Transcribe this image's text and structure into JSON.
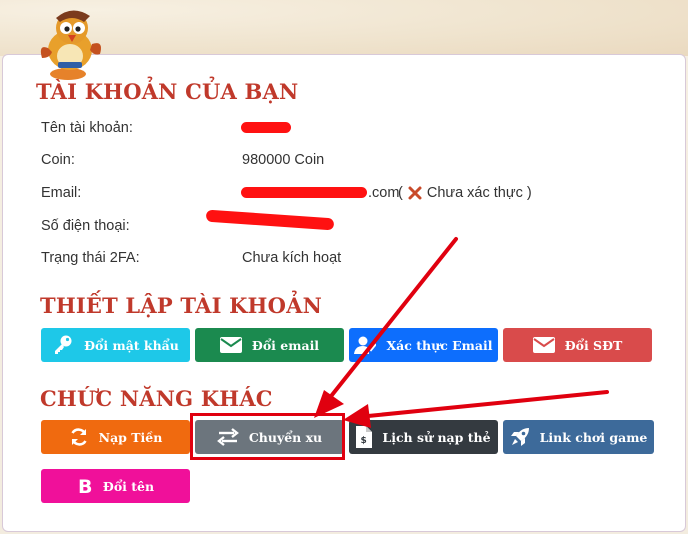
{
  "account": {
    "title": "TÀI KHOẢN CỦA BẠN",
    "rows": [
      {
        "label": "Tên tài khoản:",
        "value": ""
      },
      {
        "label": "Coin:",
        "value": "980000 Coin"
      },
      {
        "label": "Email:",
        "value": ".com"
      },
      {
        "label": "Số điện thoại:",
        "value": ""
      },
      {
        "label": "Trạng thái 2FA:",
        "value": "Chưa kích hoạt"
      }
    ],
    "email_status": "Chưa xác thực"
  },
  "settings": {
    "title": "THIẾT LẬP TÀI KHOẢN",
    "buttons": [
      {
        "label": "Đổi mật khẩu",
        "icon": "key-icon",
        "color": "#1ec8e8"
      },
      {
        "label": "Đổi email",
        "icon": "envelope-icon",
        "color": "#1b8a4f"
      },
      {
        "label": "Xác thực Email",
        "icon": "user-check-icon",
        "color": "#0d6efd"
      },
      {
        "label": "Đổi SĐT",
        "icon": "envelope-icon",
        "color": "#d94b4b"
      }
    ]
  },
  "other": {
    "title": "CHỨC NĂNG KHÁC",
    "buttons": [
      {
        "label": "Nạp Tiền",
        "icon": "refresh-icon",
        "color": "#f06a0f"
      },
      {
        "label": "Chuyển xu",
        "icon": "exchange-icon",
        "color": "#6c757d"
      },
      {
        "label": "Lịch sử nạp thẻ",
        "icon": "invoice-icon",
        "color": "#343a40"
      },
      {
        "label": "Link chơi game",
        "icon": "rocket-icon",
        "color": "#3d6a9a"
      },
      {
        "label": "Đổi tên",
        "icon": "bold-b-icon",
        "color": "#f0109a"
      }
    ]
  },
  "colors": {
    "heading": "#c0392b",
    "annotation": "#e0000f"
  }
}
